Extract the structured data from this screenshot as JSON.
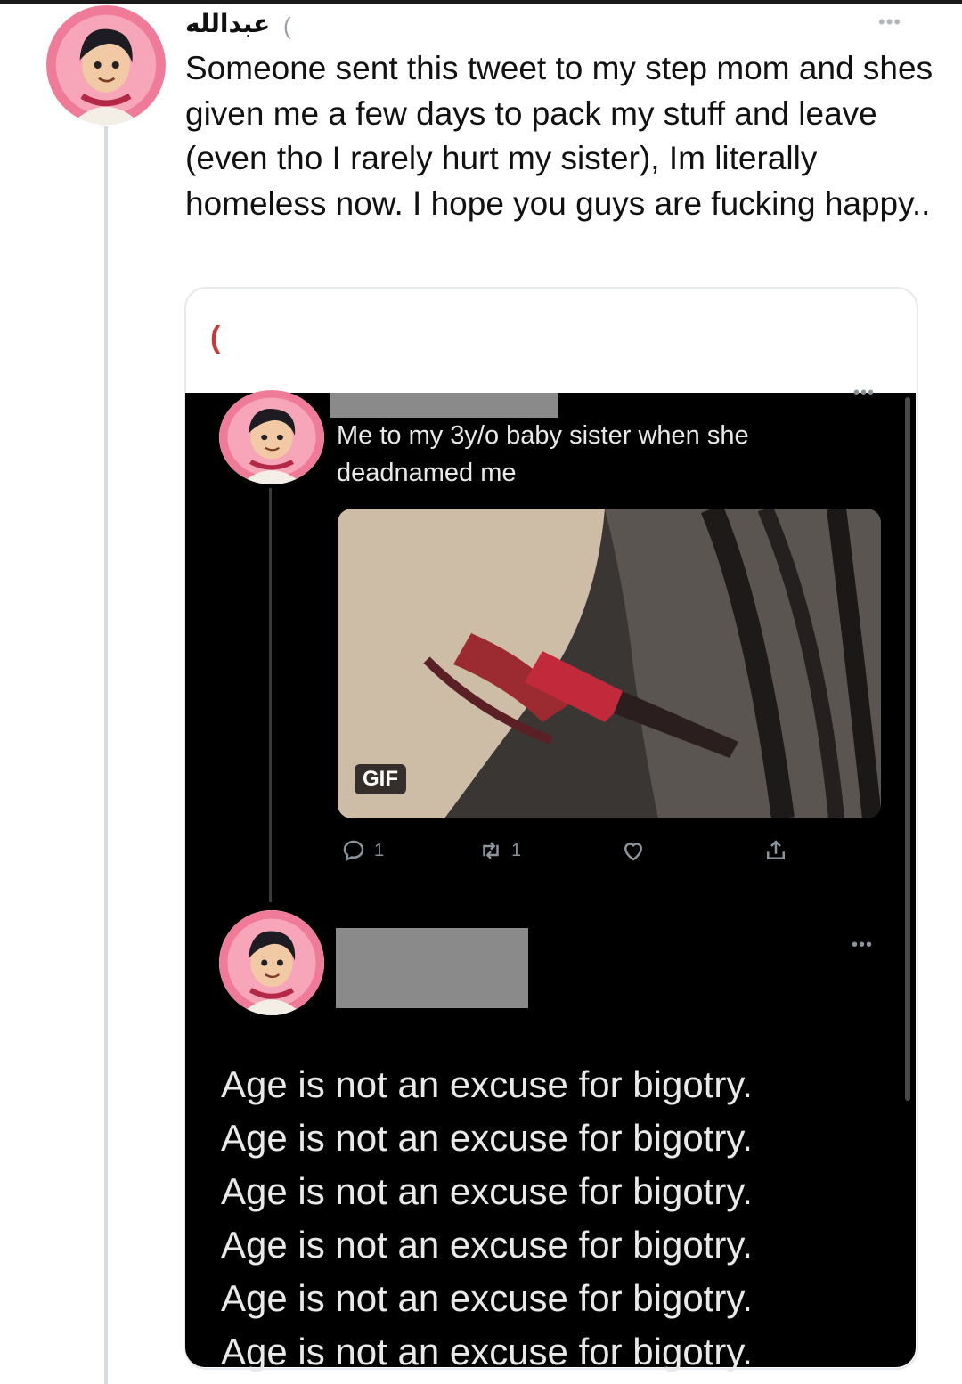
{
  "tweet": {
    "display_name": "عبدالله",
    "handle_fragment": "(",
    "more_label": "•••",
    "text": "Someone sent this tweet to my step mom and shes given me a few days to pack my stuff and leave (even tho I rarely hurt my sister), Im literally homeless now. I hope you guys are fucking happy.."
  },
  "quoted": {
    "header_fragment": "(",
    "first_tweet": {
      "text": "Me to my 3y/o baby sister when she deadnamed me",
      "media_badge": "GIF",
      "actions": {
        "reply_count": "1",
        "retweet_count": "1"
      },
      "more_label": "•••"
    },
    "second_tweet": {
      "more_label": "•••",
      "lines": [
        "Age is not an excuse for bigotry.",
        "Age is not an excuse for bigotry.",
        "Age is not an excuse for bigotry.",
        "Age is not an excuse for bigotry.",
        "Age is not an excuse for bigotry.",
        "Age is not an excuse for bigotry."
      ]
    }
  },
  "icons": [
    "avatar",
    "more-icon",
    "reply-icon",
    "retweet-icon",
    "like-icon",
    "share-icon"
  ],
  "colors": {
    "background": "#ffffff",
    "panel": "#000000",
    "avatar_ring": "#f07b98",
    "icon_gray": "#8b949b",
    "redaction": "#8a8a8a"
  }
}
